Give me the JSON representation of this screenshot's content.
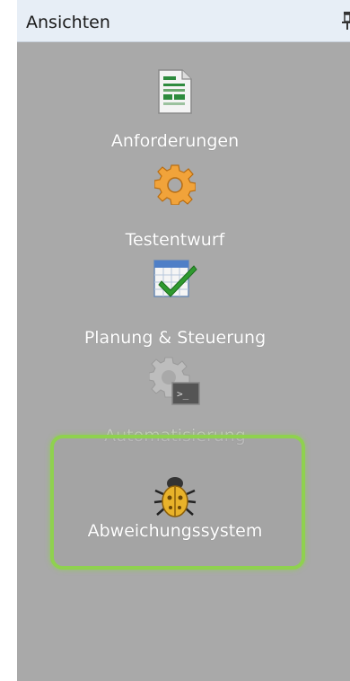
{
  "panel": {
    "title": "Ansichten",
    "pin_icon": "pin-icon"
  },
  "views": [
    {
      "label": "Anforderungen",
      "icon": "document-table-icon"
    },
    {
      "label": "Testentwurf",
      "icon": "gear-icon"
    },
    {
      "label": "Planung & Steuerung",
      "icon": "calendar-check-icon"
    },
    {
      "label": "Automatisierung",
      "icon": "gear-terminal-icon",
      "disabled": true
    },
    {
      "label": "Abweichungssystem",
      "icon": "bug-icon",
      "selected": true
    }
  ],
  "colors": {
    "panel_bg": "#a9a9a9",
    "header_bg": "#e7eef6",
    "highlight": "#8fd14f"
  }
}
